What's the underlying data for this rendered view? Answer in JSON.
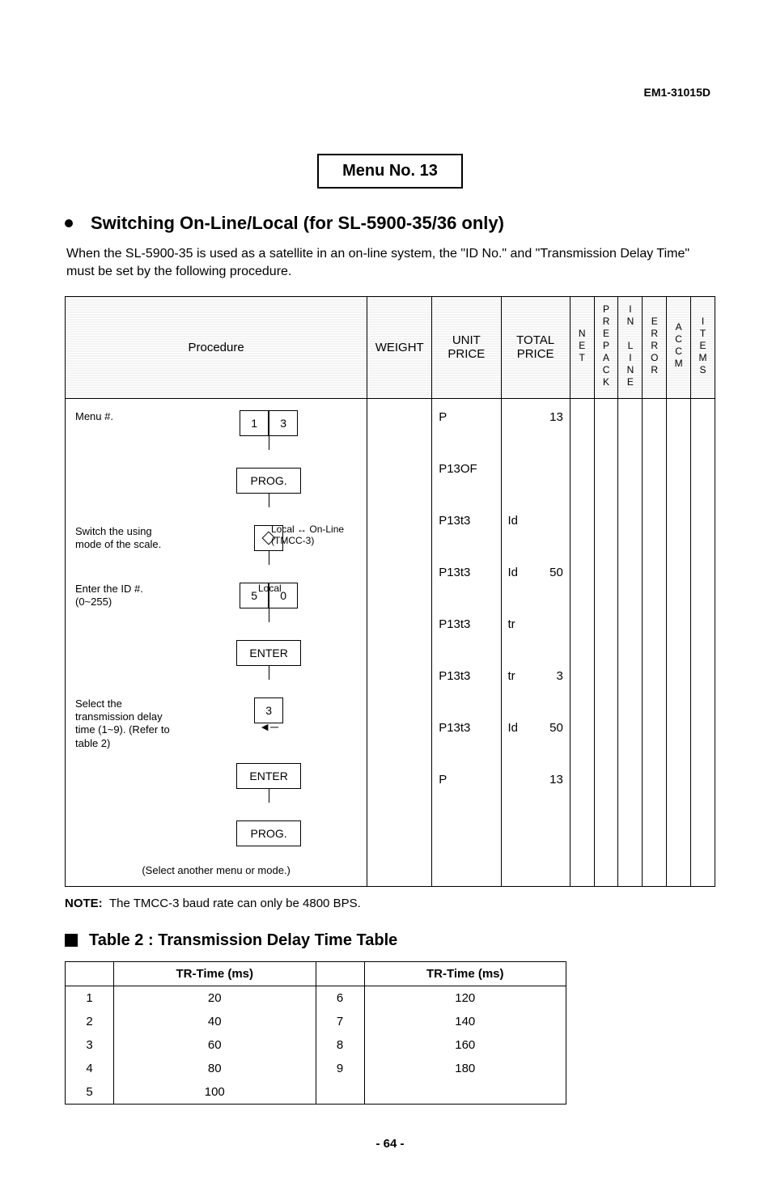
{
  "doc_id": "EM1-31015D",
  "menu_box": "Menu No. 13",
  "heading": "Switching On-Line/Local (for SL-5900-35/36 only)",
  "intro": "When the SL-5900-35 is used as a satellite in an on-line system, the \"ID No.\" and \"Transmission Delay Time\" must be set by the following procedure.",
  "cols": {
    "procedure": "Procedure",
    "weight": "WEIGHT",
    "unit_price": "UNIT PRICE",
    "total_price": "TOTAL PRICE",
    "net": "NET",
    "prepack": "PREPACK",
    "inline": "IN LINE",
    "error": "ERROR",
    "accm": "ACCM",
    "items": "ITEMS"
  },
  "steps": {
    "s1_label": "Menu #.",
    "s1_k1": "1",
    "s1_k2": "3",
    "s2_key": "PROG.",
    "s3_label": "Switch the using mode of the scale.",
    "s3_annot_top": "Local ↔ On-Line",
    "s3_annot_bot": "(TMCC-3)",
    "s4_label": "Enter the ID #. (0~255)",
    "s4_k1": "5",
    "s4_k2": "0",
    "s4_annot": "Local",
    "s5_key": "ENTER",
    "s6_label": "Select the transmission delay time (1~9). (Refer to table 2)",
    "s6_k1": "3",
    "s7_key": "ENTER",
    "s8_key": "PROG.",
    "footer": "(Select another menu or mode.)"
  },
  "unit_price_vals": [
    "P",
    "P13OF",
    "P13t3",
    "P13t3",
    "P13t3",
    "P13t3",
    "P13t3",
    "P"
  ],
  "total_price_vals": [
    {
      "l": "",
      "r": "13"
    },
    {
      "l": "",
      "r": ""
    },
    {
      "l": "Id",
      "r": ""
    },
    {
      "l": "Id",
      "r": "50"
    },
    {
      "l": "tr",
      "r": ""
    },
    {
      "l": "tr",
      "r": "3"
    },
    {
      "l": "Id",
      "r": "50"
    },
    {
      "l": "",
      "r": "13"
    }
  ],
  "note_label": "NOTE:",
  "note_text": "The TMCC-3 baud rate can only be 4800 BPS.",
  "table2_title": "Table 2 : Transmission Delay Time Table",
  "table2_header": "TR-Time (ms)",
  "chart_data": {
    "type": "table",
    "title": "Transmission Delay Time Table",
    "columns": [
      "index",
      "tr_time_ms"
    ],
    "rows": [
      {
        "index": 1,
        "tr_time_ms": 20
      },
      {
        "index": 2,
        "tr_time_ms": 40
      },
      {
        "index": 3,
        "tr_time_ms": 60
      },
      {
        "index": 4,
        "tr_time_ms": 80
      },
      {
        "index": 5,
        "tr_time_ms": 100
      },
      {
        "index": 6,
        "tr_time_ms": 120
      },
      {
        "index": 7,
        "tr_time_ms": 140
      },
      {
        "index": 8,
        "tr_time_ms": 160
      },
      {
        "index": 9,
        "tr_time_ms": 180
      }
    ]
  },
  "page_number": "- 64 -"
}
